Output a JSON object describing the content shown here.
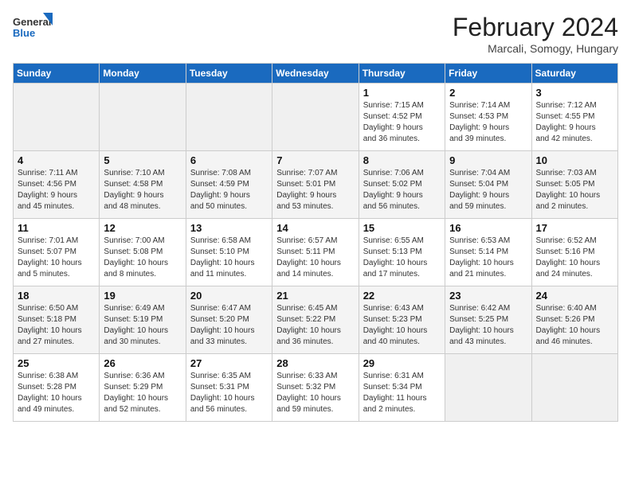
{
  "header": {
    "logo_general": "General",
    "logo_blue": "Blue",
    "month_title": "February 2024",
    "subtitle": "Marcali, Somogy, Hungary"
  },
  "days_of_week": [
    "Sunday",
    "Monday",
    "Tuesday",
    "Wednesday",
    "Thursday",
    "Friday",
    "Saturday"
  ],
  "weeks": [
    [
      {
        "num": "",
        "info": ""
      },
      {
        "num": "",
        "info": ""
      },
      {
        "num": "",
        "info": ""
      },
      {
        "num": "",
        "info": ""
      },
      {
        "num": "1",
        "info": "Sunrise: 7:15 AM\nSunset: 4:52 PM\nDaylight: 9 hours\nand 36 minutes."
      },
      {
        "num": "2",
        "info": "Sunrise: 7:14 AM\nSunset: 4:53 PM\nDaylight: 9 hours\nand 39 minutes."
      },
      {
        "num": "3",
        "info": "Sunrise: 7:12 AM\nSunset: 4:55 PM\nDaylight: 9 hours\nand 42 minutes."
      }
    ],
    [
      {
        "num": "4",
        "info": "Sunrise: 7:11 AM\nSunset: 4:56 PM\nDaylight: 9 hours\nand 45 minutes."
      },
      {
        "num": "5",
        "info": "Sunrise: 7:10 AM\nSunset: 4:58 PM\nDaylight: 9 hours\nand 48 minutes."
      },
      {
        "num": "6",
        "info": "Sunrise: 7:08 AM\nSunset: 4:59 PM\nDaylight: 9 hours\nand 50 minutes."
      },
      {
        "num": "7",
        "info": "Sunrise: 7:07 AM\nSunset: 5:01 PM\nDaylight: 9 hours\nand 53 minutes."
      },
      {
        "num": "8",
        "info": "Sunrise: 7:06 AM\nSunset: 5:02 PM\nDaylight: 9 hours\nand 56 minutes."
      },
      {
        "num": "9",
        "info": "Sunrise: 7:04 AM\nSunset: 5:04 PM\nDaylight: 9 hours\nand 59 minutes."
      },
      {
        "num": "10",
        "info": "Sunrise: 7:03 AM\nSunset: 5:05 PM\nDaylight: 10 hours\nand 2 minutes."
      }
    ],
    [
      {
        "num": "11",
        "info": "Sunrise: 7:01 AM\nSunset: 5:07 PM\nDaylight: 10 hours\nand 5 minutes."
      },
      {
        "num": "12",
        "info": "Sunrise: 7:00 AM\nSunset: 5:08 PM\nDaylight: 10 hours\nand 8 minutes."
      },
      {
        "num": "13",
        "info": "Sunrise: 6:58 AM\nSunset: 5:10 PM\nDaylight: 10 hours\nand 11 minutes."
      },
      {
        "num": "14",
        "info": "Sunrise: 6:57 AM\nSunset: 5:11 PM\nDaylight: 10 hours\nand 14 minutes."
      },
      {
        "num": "15",
        "info": "Sunrise: 6:55 AM\nSunset: 5:13 PM\nDaylight: 10 hours\nand 17 minutes."
      },
      {
        "num": "16",
        "info": "Sunrise: 6:53 AM\nSunset: 5:14 PM\nDaylight: 10 hours\nand 21 minutes."
      },
      {
        "num": "17",
        "info": "Sunrise: 6:52 AM\nSunset: 5:16 PM\nDaylight: 10 hours\nand 24 minutes."
      }
    ],
    [
      {
        "num": "18",
        "info": "Sunrise: 6:50 AM\nSunset: 5:18 PM\nDaylight: 10 hours\nand 27 minutes."
      },
      {
        "num": "19",
        "info": "Sunrise: 6:49 AM\nSunset: 5:19 PM\nDaylight: 10 hours\nand 30 minutes."
      },
      {
        "num": "20",
        "info": "Sunrise: 6:47 AM\nSunset: 5:20 PM\nDaylight: 10 hours\nand 33 minutes."
      },
      {
        "num": "21",
        "info": "Sunrise: 6:45 AM\nSunset: 5:22 PM\nDaylight: 10 hours\nand 36 minutes."
      },
      {
        "num": "22",
        "info": "Sunrise: 6:43 AM\nSunset: 5:23 PM\nDaylight: 10 hours\nand 40 minutes."
      },
      {
        "num": "23",
        "info": "Sunrise: 6:42 AM\nSunset: 5:25 PM\nDaylight: 10 hours\nand 43 minutes."
      },
      {
        "num": "24",
        "info": "Sunrise: 6:40 AM\nSunset: 5:26 PM\nDaylight: 10 hours\nand 46 minutes."
      }
    ],
    [
      {
        "num": "25",
        "info": "Sunrise: 6:38 AM\nSunset: 5:28 PM\nDaylight: 10 hours\nand 49 minutes."
      },
      {
        "num": "26",
        "info": "Sunrise: 6:36 AM\nSunset: 5:29 PM\nDaylight: 10 hours\nand 52 minutes."
      },
      {
        "num": "27",
        "info": "Sunrise: 6:35 AM\nSunset: 5:31 PM\nDaylight: 10 hours\nand 56 minutes."
      },
      {
        "num": "28",
        "info": "Sunrise: 6:33 AM\nSunset: 5:32 PM\nDaylight: 10 hours\nand 59 minutes."
      },
      {
        "num": "29",
        "info": "Sunrise: 6:31 AM\nSunset: 5:34 PM\nDaylight: 11 hours\nand 2 minutes."
      },
      {
        "num": "",
        "info": ""
      },
      {
        "num": "",
        "info": ""
      }
    ]
  ]
}
